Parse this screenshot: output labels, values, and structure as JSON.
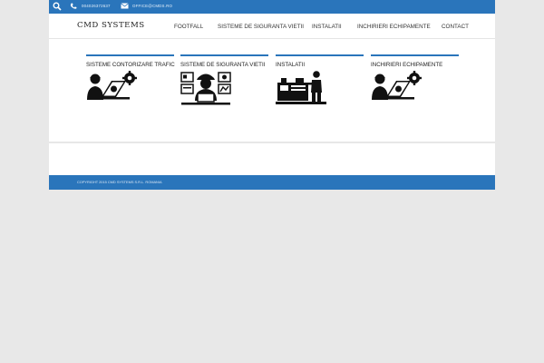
{
  "topbar": {
    "phone": "004026372637",
    "email": "OFFICE@CMDS.RO",
    "icons": [
      "search-icon",
      "phone-icon",
      "envelope-icon"
    ]
  },
  "header": {
    "logo": "CMD SYSTEMS",
    "nav": [
      "FOOTFALL",
      "SISTEME DE SIGURANTA VIETII",
      "INSTALATII",
      "INCHIRIERI ECHIPAMENTE",
      "CONTACT"
    ]
  },
  "cards": [
    {
      "title": "SISTEME CONTORIZARE TRAFIC",
      "icon": "engineer-laptop-gear-icon"
    },
    {
      "title": "SISTEME DE SIGURANTA VIETII",
      "icon": "worker-helmet-icon"
    },
    {
      "title": "INSTALATII",
      "icon": "worker-machinery-icon"
    },
    {
      "title": "INCHIRIERI ECHIPAMENTE",
      "icon": "engineer-laptop-gear-icon"
    }
  ],
  "footer": {
    "copyright": "COPYRIGHT 2015 CMD SYSTEMS S.R.L. ROMANIA"
  },
  "colors": {
    "accent": "#2a75bb",
    "background": "#e8e8e8"
  }
}
